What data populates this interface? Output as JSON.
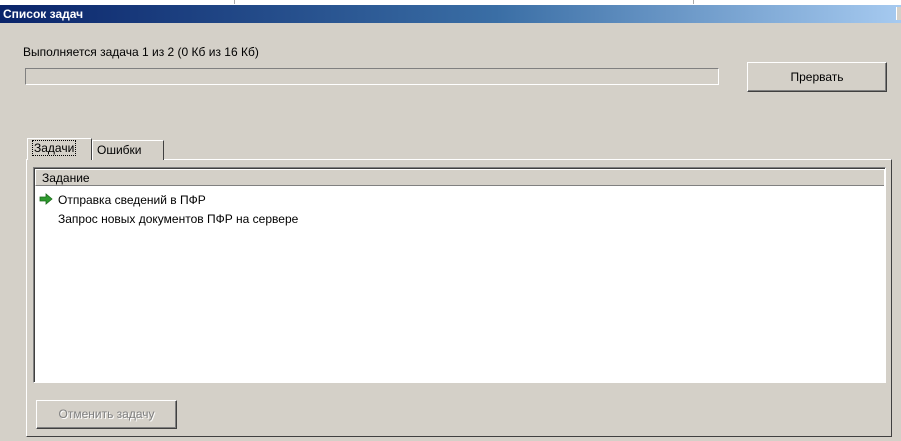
{
  "window": {
    "title": "Список задач"
  },
  "progress": {
    "status_text": "Выполняется задача 1 из 2 (0 Кб из 16 Кб)",
    "fraction": 0
  },
  "buttons": {
    "abort_label": "Прервать",
    "cancel_task_label": "Отменить задачу"
  },
  "tabs": [
    {
      "label": "Задачи",
      "selected": true
    },
    {
      "label": "Ошибки",
      "selected": false
    }
  ],
  "task_list": {
    "column_header": "Задание",
    "rows": [
      {
        "label": "Отправка сведений в ПФР",
        "icon": "green-arrow-icon",
        "current": true
      },
      {
        "label": "Запрос новых документов ПФР на сервере",
        "icon": "",
        "current": false
      }
    ]
  },
  "colors": {
    "titlebar_start": "#0a246a",
    "titlebar_end": "#a6caf0",
    "current_task_arrow": "#2e9a2e"
  }
}
